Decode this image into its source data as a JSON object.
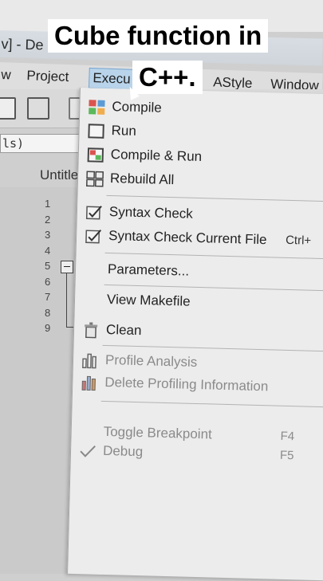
{
  "caption": {
    "line1": "Cube function in",
    "line2": "C++."
  },
  "window": {
    "title": "v] - De"
  },
  "menubar": {
    "items": [
      {
        "label": "w"
      },
      {
        "label": "Project"
      },
      {
        "label": "Execu"
      },
      {
        "label": "AStyle"
      },
      {
        "label": "Window"
      }
    ]
  },
  "toolbar": {
    "combo_value": "ls)"
  },
  "editor": {
    "tab_label": "Untitle",
    "line_numbers": [
      "1",
      "2",
      "3",
      "4",
      "5",
      "6",
      "7",
      "8",
      "9"
    ]
  },
  "execute_menu": {
    "items": [
      {
        "label": "Compile",
        "icon": "compile-icon",
        "shortcut": ""
      },
      {
        "label": "Run",
        "icon": "run-icon",
        "shortcut": ""
      },
      {
        "label": "Compile & Run",
        "icon": "compile-run-icon",
        "shortcut": ""
      },
      {
        "label": "Rebuild All",
        "icon": "rebuild-all-icon",
        "shortcut": ""
      },
      {
        "label": "Syntax Check",
        "icon": "syntax-check-icon",
        "shortcut": ""
      },
      {
        "label": "Syntax Check Current File",
        "icon": "syntax-check-file-icon",
        "shortcut": "Ctrl+"
      },
      {
        "label": "Parameters...",
        "icon": "",
        "shortcut": ""
      },
      {
        "label": "View Makefile",
        "icon": "",
        "shortcut": ""
      },
      {
        "label": "Clean",
        "icon": "clean-icon",
        "shortcut": ""
      },
      {
        "label": "Profile Analysis",
        "icon": "profile-analysis-icon",
        "shortcut": ""
      },
      {
        "label": "Delete Profiling Information",
        "icon": "delete-profiling-icon",
        "shortcut": ""
      },
      {
        "label": "Toggle Breakpoint",
        "icon": "",
        "shortcut": "F4"
      },
      {
        "label": "Debug",
        "icon": "debug-check-icon",
        "shortcut": "F5"
      }
    ]
  }
}
